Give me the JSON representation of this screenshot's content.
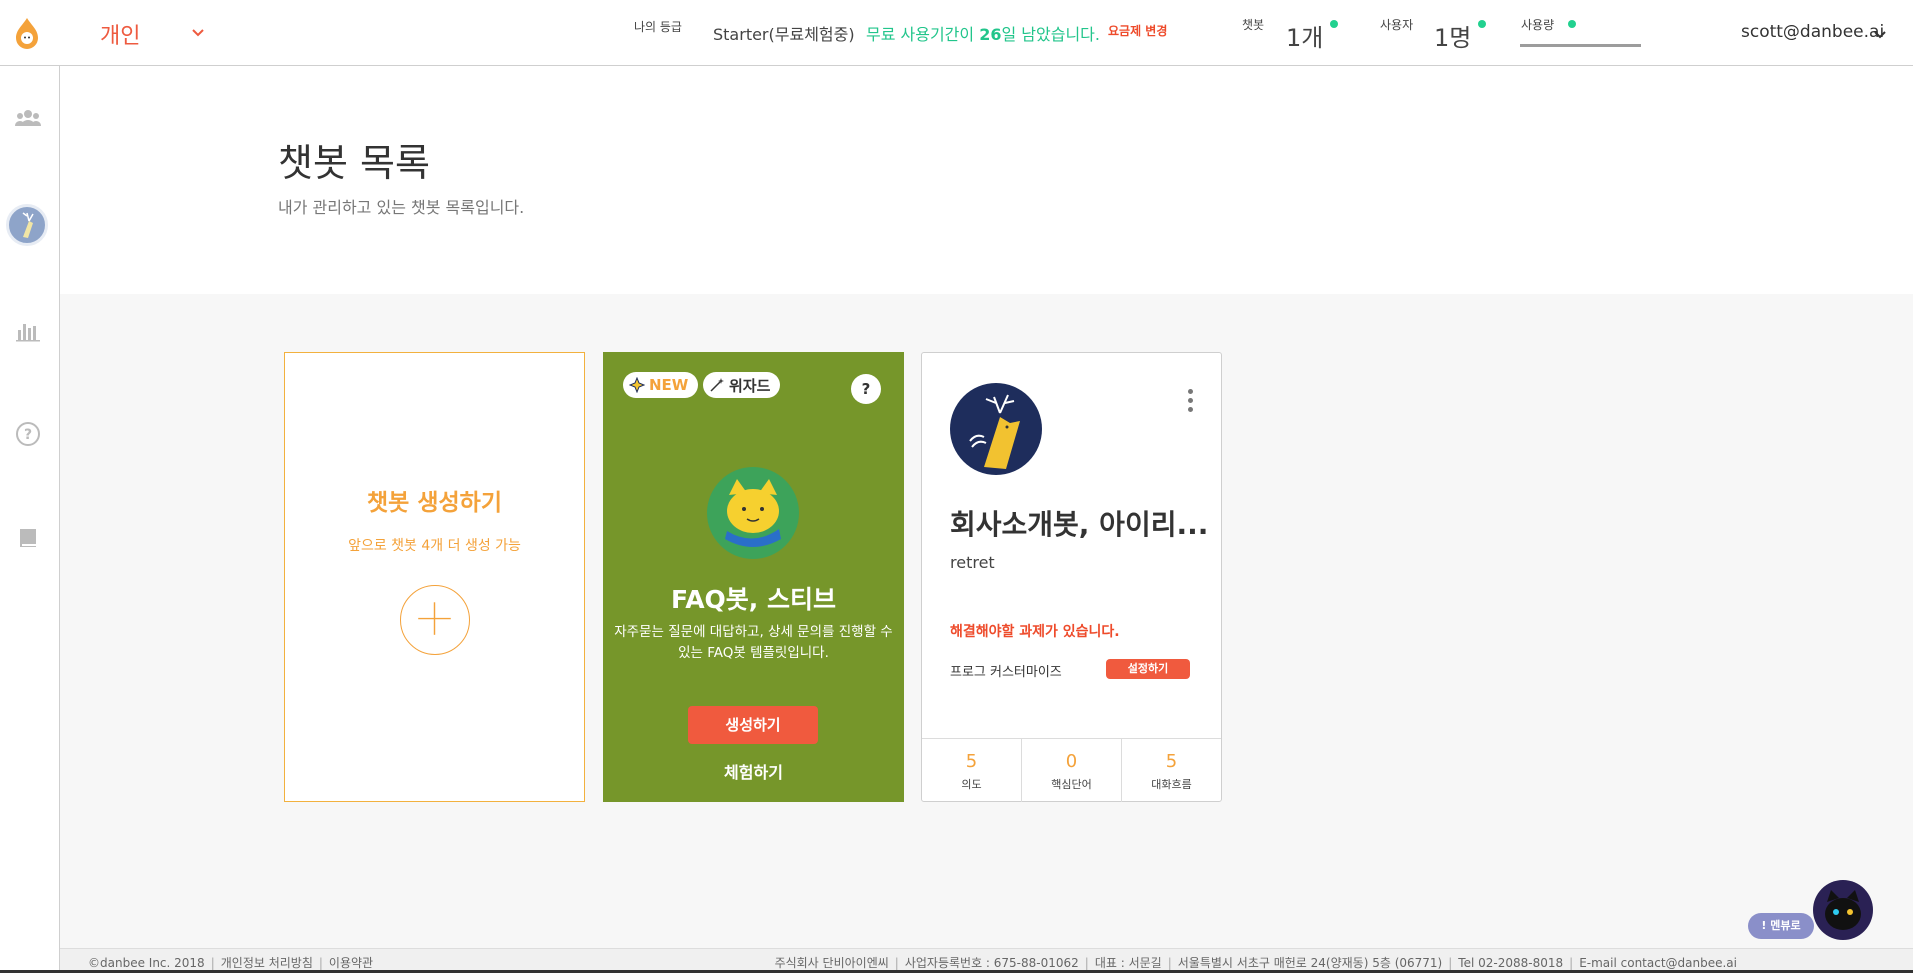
{
  "header": {
    "workspace": "개인",
    "grade_label": "나의 등급",
    "grade_value": "Starter(무료체험중)",
    "trial_prefix": "무료 사용기간이 ",
    "trial_days": "26",
    "trial_suffix": "일 남았습니다.",
    "plan_change": "요금제 변경",
    "chatbot_label": "챗봇",
    "chatbot_value": "1개",
    "user_label": "사용자",
    "user_value": "1명",
    "usage_label": "사용량",
    "account": "scott@danbee.ai"
  },
  "sidebar": {
    "icons": [
      "users-icon",
      "bot-avatar",
      "bar-chart-icon",
      "help-circle-icon",
      "book-icon"
    ]
  },
  "page": {
    "title": "챗봇 목록",
    "subtitle": "내가 관리하고 있는 챗봇 목록입니다."
  },
  "create_card": {
    "title": "챗봇 생성하기",
    "subtitle": "앞으로 챗봇 4개 더 생성 가능"
  },
  "faq_card": {
    "badge_new": "NEW",
    "badge_wizard": "위자드",
    "help": "?",
    "title": "FAQ봇, 스티브",
    "description": "자주묻는 질문에 대답하고, 상세 문의를 진행할 수 있는 FAQ봇 템플릿입니다.",
    "create_label": "생성하기",
    "try_label": "체험하기"
  },
  "bot_card": {
    "name": "회사소개봇, 아이리...",
    "description": "retret",
    "warning": "해결해야할 과제가 있습니다.",
    "task_label": "프로그 커스터마이즈",
    "task_button": "설정하기",
    "stats": [
      {
        "value": "5",
        "label": "의도"
      },
      {
        "value": "0",
        "label": "핵심단어"
      },
      {
        "value": "5",
        "label": "대화흐름"
      }
    ]
  },
  "floating": {
    "menu_label": "! 멘뷰로"
  },
  "footer": {
    "copyright": "©danbee Inc. 2018",
    "privacy": "개인정보 처리방침",
    "terms": "이용약관",
    "company": "주식회사 단비아이엔씨",
    "biz_no": "사업자등록번호 : 675-88-01062",
    "ceo": "대표 : 서문길",
    "address": "서울특별시 서초구 매헌로 24(양재동) 5층 (06771)",
    "tel": "Tel 02-2088-8018",
    "email": "E-mail contact@danbee.ai"
  },
  "colors": {
    "accent": "#ee5a3f",
    "orange": "#f4a23a",
    "green": "#22c58b",
    "faq_bg": "#76962a"
  }
}
